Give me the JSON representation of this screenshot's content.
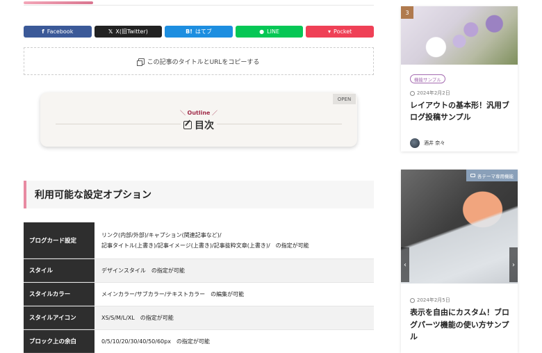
{
  "share": {
    "buttons": [
      {
        "icon": "f",
        "label": "Facebook",
        "color": "#3b5998"
      },
      {
        "icon": "𝕏",
        "label": "X(旧Twitter)",
        "color": "#222222"
      },
      {
        "icon": "B!",
        "label": "はてブ",
        "color": "#1d8ee0"
      },
      {
        "icon": "●",
        "label": "LINE",
        "color": "#06c755"
      },
      {
        "icon": "▾",
        "label": "Pocket",
        "color": "#ef4056"
      }
    ],
    "copy_label": "この記事のタイトルとURLをコピーする"
  },
  "toc": {
    "open_label": "OPEN",
    "outline_label": "Outline",
    "title": "目次"
  },
  "section": {
    "heading": "利用可能な設定オプション"
  },
  "table": {
    "rows": [
      {
        "key": "ブログカード設定",
        "lines": [
          "リンク(内部/外部)/キャプション(関連記事など)/",
          "記事タイトル(上書き)/記事イメージ(上書き)/記事抜粋文章(上書き)/　の指定が可能"
        ]
      },
      {
        "key": "スタイル",
        "lines": [
          "デザインスタイル　の指定が可能"
        ]
      },
      {
        "key": "スタイルカラー",
        "lines": [
          "メインカラー/サブカラー/テキストカラー　の編集が可能"
        ]
      },
      {
        "key": "スタイルアイコン",
        "lines": [
          "XS/S/M/L/XL　の指定が可能"
        ]
      },
      {
        "key": "ブロック上の余白",
        "lines": [
          "0/5/10/20/30/40/50/60px　の指定が可能"
        ]
      }
    ]
  },
  "sidebar": {
    "card1": {
      "rank": "3",
      "category": "機能サンプル",
      "date": "2024年2月2日",
      "title": "レイアウトの基本形！汎用ブログ投稿サンプル",
      "author": "酒井 奈々"
    },
    "card2": {
      "category": "各テーマ専用機能",
      "date": "2024年2月5日",
      "title": "表示を自由にカスタム！ブログパーツ機能の使い方サンプル",
      "prev_arrow": "‹",
      "next_arrow": "›"
    }
  },
  "colors": {
    "accent": "#e88aa2",
    "outline": "#a12d4a",
    "table_header": "#2e2e2e"
  }
}
